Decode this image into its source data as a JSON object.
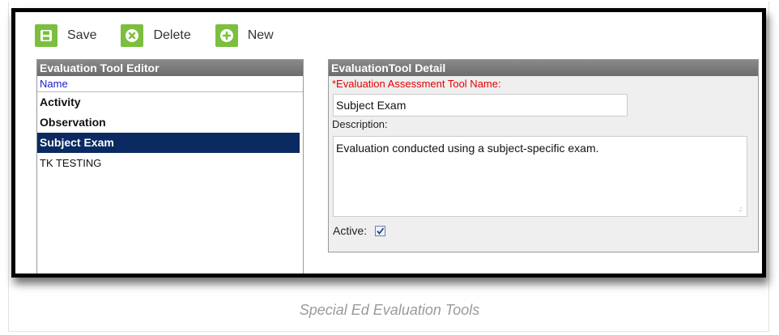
{
  "toolbar": {
    "save_label": "Save",
    "delete_label": "Delete",
    "new_label": "New"
  },
  "editor": {
    "title": "Evaluation Tool Editor",
    "column_name": "Name",
    "items": [
      {
        "label": "Activity"
      },
      {
        "label": "Observation"
      },
      {
        "label": "Subject Exam"
      },
      {
        "label": "TK TESTING"
      }
    ]
  },
  "detail": {
    "title": "EvaluationTool Detail",
    "name_label": "*Evaluation Assessment Tool Name:",
    "name_value": "Subject Exam",
    "description_label": "Description:",
    "description_value": "Evaluation conducted using a subject-specific exam.",
    "active_label": "Active:",
    "active_checked": true
  },
  "caption": "Special Ed Evaluation Tools",
  "colors": {
    "toolbar_icon": "#7cbf3e",
    "selected_row": "#0b2a62",
    "required_label": "#e60000",
    "column_header": "#1a1acc"
  }
}
